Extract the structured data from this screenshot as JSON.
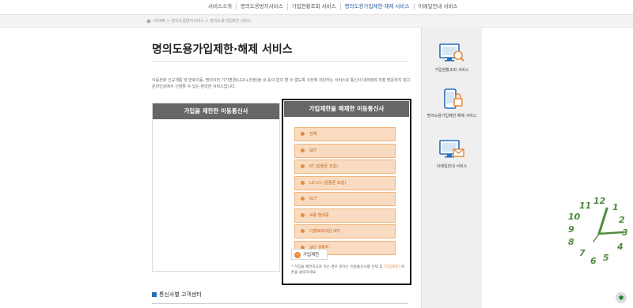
{
  "topnav": {
    "items": [
      "서비스소개",
      "명의도용방지서비스",
      "가입현황조회 서비스",
      "명의도용가입제한·해제 서비스",
      "이메일안내 서비스"
    ],
    "active_index": 3
  },
  "breadcrumb": "HOME > 명의도용방지서비스 > 명의도용가입제한 서비스",
  "page_title": "명의도용가입제한·해제 서비스",
  "description": "이동전화 신규개통 및 번호이동, 명의이전 기기변경(LGU+한정)을 내 동의 없이 할 수 없도록 사전에 차단하는 서비스로 통신사 대리점에 직접 방문하지 않고 온라인상에서 신청할 수 있는 편리한 서비스입니다.",
  "panel_left": {
    "title": "가입을 제한한 이동통신사"
  },
  "panel_right": {
    "title": "가입제한을 해제한 이동통신사",
    "carriers": [
      "전체",
      "SKT",
      "KT (알뜰폰 포함)",
      "LG U+ (알뜰폰 포함)",
      "KCT",
      "세종 텔레콤",
      "CJ헬로모바일 (KT)",
      "SKT 알뜰폰"
    ],
    "button_label": "가입제한",
    "note_before": "* 가입을 제한하고자 하는 경우 원하는 이동통신사를 선택 후",
    "note_link": "[가입제한]",
    "note_after": "버튼을 클릭하세요."
  },
  "section_heading": "통신사별 고객센터",
  "sidebar": {
    "items": [
      "가입현황조회 서비스",
      "명의도용가입제한·해제 서비스",
      "이메일안내 서비스"
    ]
  },
  "clock_numbers": [
    "11",
    "12",
    "1",
    "2",
    "3",
    "4",
    "5",
    "6",
    "7",
    "8",
    "9",
    "10"
  ],
  "colors": {
    "accent": "#e68a3c",
    "panel_head": "#666666",
    "active_nav": "#2a5fa8",
    "clock": "#4f8a3f"
  }
}
